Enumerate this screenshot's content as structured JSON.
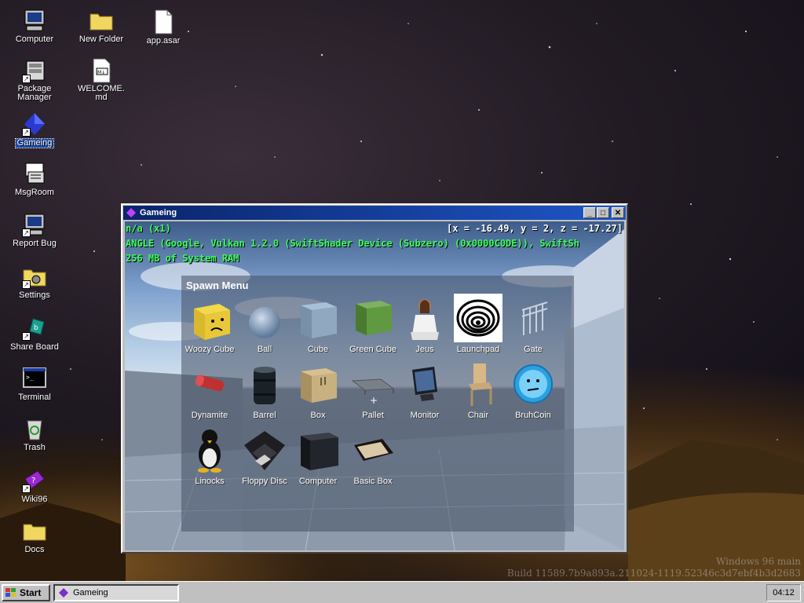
{
  "desktop": {
    "icons": [
      {
        "label": "Computer",
        "icon": "computer-icon"
      },
      {
        "label": "New Folder",
        "icon": "folder-icon"
      },
      {
        "label": "app.asar",
        "icon": "file-icon"
      },
      {
        "label": "Package Manager",
        "icon": "package-manager-icon"
      },
      {
        "label": "WELCOME.md",
        "icon": "markdown-file-icon"
      },
      {
        "label": "Gameing",
        "icon": "gameing-icon"
      },
      {
        "label": "MsgRoom",
        "icon": "msgroom-icon"
      },
      {
        "label": "Report Bug",
        "icon": "report-bug-icon"
      },
      {
        "label": "Settings",
        "icon": "settings-icon"
      },
      {
        "label": "Share Board",
        "icon": "share-board-icon"
      },
      {
        "label": "Terminal",
        "icon": "terminal-icon"
      },
      {
        "label": "Trash",
        "icon": "trash-icon"
      },
      {
        "label": "Wiki96",
        "icon": "wiki-icon"
      },
      {
        "label": "Docs",
        "icon": "folder-icon"
      }
    ]
  },
  "window": {
    "title": "Gameing",
    "debug_line1": "n/a (x1)",
    "coords": "[x = -16.49, y = 2, z = -17.27]",
    "debug_line2": "ANGLE (Google, Vulkan 1.2.0 (SwiftShader Device (Subzero) (0x0000C0DE)), SwiftSh",
    "debug_line3": "256 MB of System RAM"
  },
  "spawn_menu": {
    "title": "Spawn Menu",
    "items": [
      {
        "label": "Woozy Cube",
        "icon": "woozy-cube-icon"
      },
      {
        "label": "Ball",
        "icon": "ball-icon"
      },
      {
        "label": "Cube",
        "icon": "cube-icon"
      },
      {
        "label": "Green Cube",
        "icon": "green-cube-icon"
      },
      {
        "label": "Jeus",
        "icon": "jeus-icon"
      },
      {
        "label": "Launchpad",
        "icon": "launchpad-icon"
      },
      {
        "label": "Gate",
        "icon": "gate-icon"
      },
      {
        "label": "Dynamite",
        "icon": "dynamite-icon"
      },
      {
        "label": "Barrel",
        "icon": "barrel-icon"
      },
      {
        "label": "Box",
        "icon": "box-icon"
      },
      {
        "label": "Pallet",
        "icon": "pallet-icon"
      },
      {
        "label": "Monitor",
        "icon": "monitor-icon"
      },
      {
        "label": "Chair",
        "icon": "chair-icon"
      },
      {
        "label": "BruhCoin",
        "icon": "bruhcoin-icon"
      },
      {
        "label": "Linocks",
        "icon": "linocks-icon"
      },
      {
        "label": "Floppy Disc",
        "icon": "floppy-disc-icon"
      },
      {
        "label": "Computer",
        "icon": "computer-icon"
      },
      {
        "label": "Basic Box",
        "icon": "basic-box-icon"
      }
    ]
  },
  "taskbar": {
    "start_label": "Start",
    "task_label": "Gameing",
    "clock": "04:12"
  },
  "watermark": {
    "line1": "Windows 96 main",
    "line2": "Build 11589.7b9a893a.211024-1119.52346c3d7ebf4b3d2683"
  },
  "colors": {
    "titlebar": "#0a246a",
    "debug_text": "#3cff5a",
    "selection": "#1e4fb3"
  }
}
